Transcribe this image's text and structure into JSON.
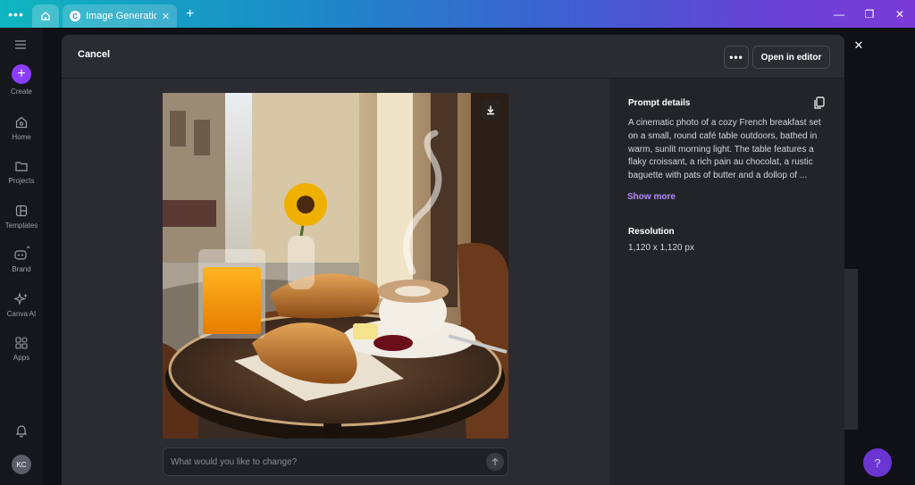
{
  "browser": {
    "tab_title": "Image Generation -...",
    "tab_favicon_letter": "C"
  },
  "sidebar": {
    "items": [
      {
        "label": "Create",
        "icon": "plus-icon"
      },
      {
        "label": "Home",
        "icon": "home-icon"
      },
      {
        "label": "Projects",
        "icon": "folder-icon"
      },
      {
        "label": "Templates",
        "icon": "templates-icon"
      },
      {
        "label": "Brand",
        "icon": "brand-icon"
      },
      {
        "label": "Canva AI",
        "icon": "sparkle-icon"
      },
      {
        "label": "Apps",
        "icon": "apps-icon"
      }
    ],
    "avatar_initials": "KC"
  },
  "modal": {
    "cancel_label": "Cancel",
    "more_label": "•••",
    "open_editor_label": "Open in editor",
    "image_alt": "A cinematic photo of a cozy French breakfast set",
    "input_placeholder": "What would you like to change?",
    "prompt_details_title": "Prompt details",
    "prompt_text": "A cinematic photo of a cozy French breakfast set on a small, round café table outdoors, bathed in warm, sunlit morning light.  The table features a flaky croissant, a rich pain au chocolat, a rustic baguette with pats of butter and a dollop of ...",
    "show_more_label": "Show more",
    "resolution_title": "Resolution",
    "resolution_value": "1,120 x 1,120 px"
  },
  "help_label": "?",
  "colors": {
    "accent": "#8b3dff",
    "link": "#b38bff",
    "modal_bg": "#2b2c31",
    "side_bg": "#232428"
  }
}
